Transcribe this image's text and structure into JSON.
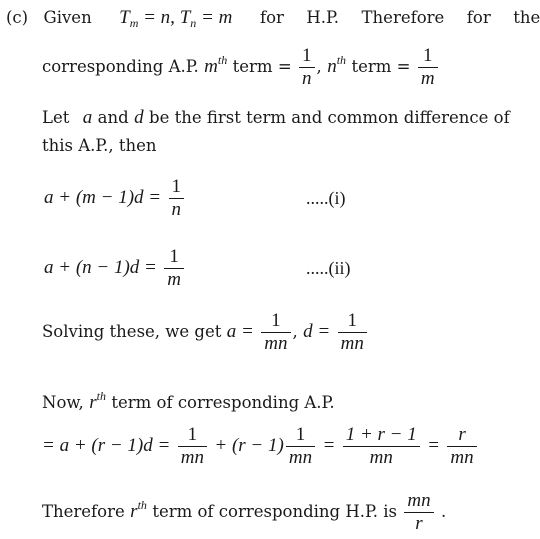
{
  "solution": {
    "label": "(c)",
    "line1": {
      "given": "Given",
      "cond_T": "T",
      "cond_m_sub": "m",
      "cond_eq1": " = n, ",
      "cond_T2": "T",
      "cond_n_sub": "n",
      "cond_eq2": " = m",
      "rest": "for  H.P.  Therefore  for  the"
    },
    "line2": {
      "prefix": "corresponding A.P.",
      "m_var": "m",
      "th": "th",
      "term": "term =",
      "frac1_num": "1",
      "frac1_den": "n",
      "comma": ",",
      "n_var": "n",
      "th2": "th",
      "term2": "term =",
      "frac2_num": "1",
      "frac2_den": "m"
    },
    "line3": {
      "let": "Let",
      "a_var": "a",
      "and": "and",
      "d_var": "d",
      "rest": "be the first term and common difference of"
    },
    "line4": "this A.P., then",
    "eq1": {
      "lhs": "a + (m − 1)d =",
      "num": "1",
      "den": "n",
      "tag": ".....(i)"
    },
    "eq2": {
      "lhs": "a + (n − 1)d =",
      "num": "1",
      "den": "m",
      "tag": ".....(ii)"
    },
    "solving": {
      "text": "Solving these, we get",
      "a_eq": "a =",
      "a_num": "1",
      "a_den": "mn",
      "comma": ",",
      "d_eq": "d =",
      "d_num": "1",
      "d_den": "mn"
    },
    "now": {
      "prefix": "Now,",
      "r_var": "r",
      "th": "th",
      "rest": "term of corresponding A.P."
    },
    "rterm": {
      "lhs": "= a + (r − 1)d =",
      "f1_num": "1",
      "f1_den": "mn",
      "mid": "+ (r − 1)",
      "f2_num": "1",
      "f2_den": "mn",
      "eq2": "=",
      "f3_num": "1 + r − 1",
      "f3_den": "mn",
      "eq3": "=",
      "f4_num": "r",
      "f4_den": "mn"
    },
    "conclusion": {
      "prefix": "Therefore",
      "r_var": "r",
      "th": "th",
      "rest": "term of corresponding H.P. is",
      "num": "mn",
      "den": "r",
      "end": "."
    }
  }
}
